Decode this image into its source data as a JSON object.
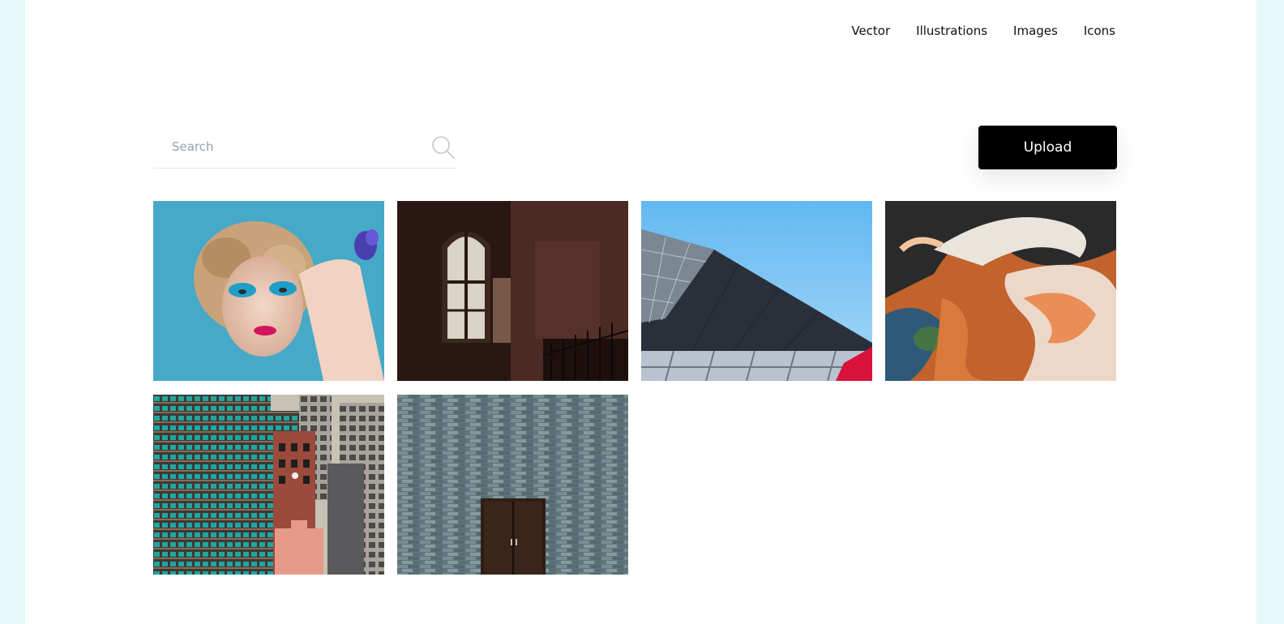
{
  "nav": {
    "items": [
      {
        "label": "Vector"
      },
      {
        "label": "Illustrations"
      },
      {
        "label": "Images"
      },
      {
        "label": "Icons"
      }
    ]
  },
  "search": {
    "placeholder": "Search",
    "value": "",
    "icon": "search-icon"
  },
  "upload": {
    "label": "Upload"
  },
  "gallery": {
    "photos": [
      {
        "subject": "portrait-makeup"
      },
      {
        "subject": "arched-window-interior"
      },
      {
        "subject": "glass-roof-architecture"
      },
      {
        "subject": "aerial-abstract-landscape"
      },
      {
        "subject": "city-apartment-buildings"
      },
      {
        "subject": "stone-wall-door"
      }
    ]
  },
  "colors": {
    "background": "#e6f8f7",
    "page": "#ffffff",
    "button": "#000000"
  }
}
